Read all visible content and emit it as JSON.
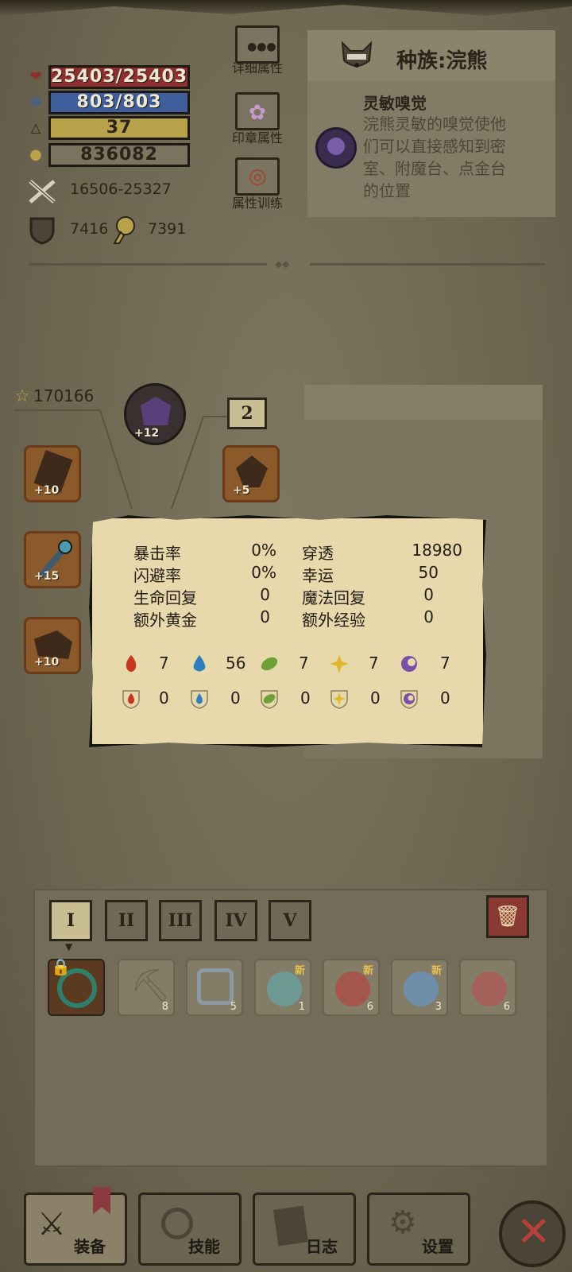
{
  "stats": {
    "hp": "25403/25403",
    "mp": "803/803",
    "level": "37",
    "gold": "836082",
    "attack": "16506-25327",
    "defense": "7416",
    "magic_defense": "7391"
  },
  "menu": {
    "detail": "详细属性",
    "seal": "印章属性",
    "training": "属性训练"
  },
  "race": {
    "title": "种族:浣熊",
    "skill_name": "灵敏嗅觉",
    "skill_desc_lines": [
      "浣熊灵敏的嗅觉使他",
      "们可以直接感知到密",
      "室、附魔台、点金台",
      "的位置"
    ]
  },
  "equipment": {
    "power": "170166",
    "helmet_plus": "+12",
    "box_number": "2",
    "armor_plus": "+5",
    "weapon_plus": "+10",
    "staff_plus": "+15",
    "boots_plus": "+10"
  },
  "popup": {
    "rows": [
      {
        "l1": "暴击率",
        "v1": "0%",
        "l2": "穿透",
        "v2": "18980"
      },
      {
        "l1": "闪避率",
        "v1": "0%",
        "l2": "幸运",
        "v2": "50"
      },
      {
        "l1": "生命回复",
        "v1": "0",
        "l2": "魔法回复",
        "v2": "0"
      },
      {
        "l1": "额外黄金",
        "v1": "0",
        "l2": "额外经验",
        "v2": "0"
      }
    ],
    "element_attack": [
      "7",
      "56",
      "7",
      "7",
      "7"
    ],
    "element_resist": [
      "0",
      "0",
      "0",
      "0",
      "0"
    ],
    "element_colors": [
      "#c8361d",
      "#2f7fc0",
      "#6ea03a",
      "#e0b82c",
      "#7a4fa8"
    ]
  },
  "inventory": {
    "tabs": [
      "I",
      "II",
      "III",
      "IV",
      "V"
    ],
    "slots": [
      {
        "count": "",
        "new": ""
      },
      {
        "count": "8",
        "new": ""
      },
      {
        "count": "5",
        "new": ""
      },
      {
        "count": "1",
        "new": "新"
      },
      {
        "count": "6",
        "new": "新"
      },
      {
        "count": "3",
        "new": "新"
      },
      {
        "count": "6",
        "new": ""
      }
    ]
  },
  "nav": {
    "equip": "装备",
    "skill": "技能",
    "log": "日志",
    "settings": "设置"
  },
  "colors": {
    "hp_bar": "#8f2e2e",
    "mp_bar": "#3e5f9c",
    "level_bar": "#b8a34a",
    "gold_bar": "#7b7461"
  }
}
